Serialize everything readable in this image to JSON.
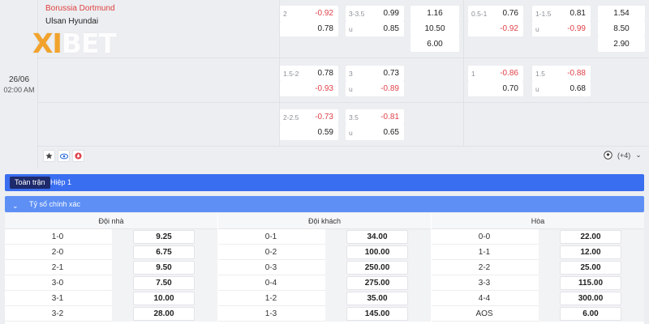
{
  "match": {
    "home_team": "Borussia Dortmund",
    "away_team": "Ulsan Hyundai",
    "date": "26/06",
    "time": "02:00 AM",
    "logo": {
      "prefix": "XI",
      "suffix": "BET"
    },
    "more_markets": "(+4)"
  },
  "odds_rows": [
    [
      {
        "label": "2",
        "value": "-0.92",
        "neg": true
      },
      {
        "label": "3-3.5",
        "value": "0.99",
        "neg": false
      },
      {
        "label": "",
        "value": "1.16",
        "neg": false
      },
      {
        "label": "0.5-1",
        "value": "0.76",
        "neg": false
      },
      {
        "label": "1-1.5",
        "value": "0.81",
        "neg": false
      },
      {
        "label": "",
        "value": "1.54",
        "neg": false
      }
    ],
    [
      {
        "label": "",
        "value": "0.78",
        "neg": false
      },
      {
        "label": "u",
        "value": "0.85",
        "neg": false
      },
      {
        "label": "",
        "value": "10.50",
        "neg": false
      },
      {
        "label": "",
        "value": "-0.92",
        "neg": true
      },
      {
        "label": "u",
        "value": "-0.99",
        "neg": true
      },
      {
        "label": "",
        "value": "8.50",
        "neg": false
      }
    ],
    [
      {
        "label": "",
        "value": "6.00",
        "neg": false
      },
      {
        "label": "",
        "value": "2.90",
        "neg": false
      }
    ],
    [
      {
        "label": "1.5-2",
        "value": "0.78",
        "neg": false
      },
      {
        "label": "3",
        "value": "0.73",
        "neg": false
      },
      {
        "label": "1",
        "value": "-0.86",
        "neg": true
      },
      {
        "label": "1.5",
        "value": "-0.88",
        "neg": true
      }
    ],
    [
      {
        "label": "",
        "value": "-0.93",
        "neg": true
      },
      {
        "label": "u",
        "value": "-0.89",
        "neg": true
      },
      {
        "label": "",
        "value": "0.70",
        "neg": false
      },
      {
        "label": "u",
        "value": "0.68",
        "neg": false
      }
    ],
    [
      {
        "label": "2-2.5",
        "value": "-0.73",
        "neg": true
      },
      {
        "label": "3.5",
        "value": "-0.81",
        "neg": true
      }
    ],
    [
      {
        "label": "",
        "value": "0.59",
        "neg": false
      },
      {
        "label": "u",
        "value": "0.65",
        "neg": false
      }
    ]
  ],
  "tabs": [
    "Toàn trận",
    "Hiệp 1"
  ],
  "section_title": "Tỷ số chính xác",
  "columns": [
    {
      "header": "Đội nhà",
      "rows": [
        [
          "1-0",
          "9.25"
        ],
        [
          "2-0",
          "6.75"
        ],
        [
          "2-1",
          "9.50"
        ],
        [
          "3-0",
          "7.50"
        ],
        [
          "3-1",
          "10.00"
        ],
        [
          "3-2",
          "28.00"
        ]
      ]
    },
    {
      "header": "Đội khách",
      "rows": [
        [
          "0-1",
          "34.00"
        ],
        [
          "0-2",
          "100.00"
        ],
        [
          "0-3",
          "250.00"
        ],
        [
          "0-4",
          "275.00"
        ],
        [
          "1-2",
          "35.00"
        ],
        [
          "1-3",
          "145.00"
        ]
      ]
    },
    {
      "header": "Hòa",
      "rows": [
        [
          "0-0",
          "22.00"
        ],
        [
          "1-1",
          "12.00"
        ],
        [
          "2-2",
          "25.00"
        ],
        [
          "3-3",
          "115.00"
        ],
        [
          "4-4",
          "300.00"
        ],
        [
          "AOS",
          "6.00"
        ]
      ]
    }
  ]
}
